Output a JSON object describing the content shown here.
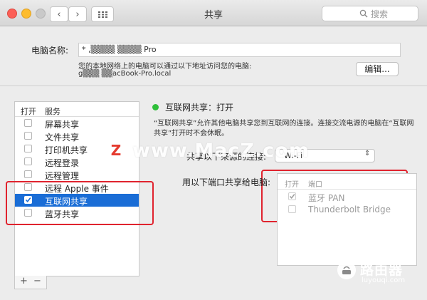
{
  "window": {
    "title": "共享"
  },
  "toolbar": {
    "search_placeholder": "搜索",
    "grid_icon": "grid-icon"
  },
  "computer_name": {
    "label": "电脑名称:",
    "value": "* ,▒▒▒▒ ▒▒▒▒ Pro",
    "hint": "您的本地网络上的电脑可以通过以下地址访问您的电脑:",
    "address": "g▒▒▒ ▒▒acBook-Pro.local",
    "edit_button": "编辑..."
  },
  "services": {
    "header_on": "打开",
    "header_service": "服务",
    "items": [
      {
        "label": "屏幕共享",
        "checked": false,
        "selected": false
      },
      {
        "label": "文件共享",
        "checked": false,
        "selected": false
      },
      {
        "label": "打印机共享",
        "checked": false,
        "selected": false
      },
      {
        "label": "远程登录",
        "checked": false,
        "selected": false
      },
      {
        "label": "远程管理",
        "checked": false,
        "selected": false
      },
      {
        "label": "远程 Apple 事件",
        "checked": false,
        "selected": false
      },
      {
        "label": "互联网共享",
        "checked": true,
        "selected": true
      },
      {
        "label": "蓝牙共享",
        "checked": false,
        "selected": false
      }
    ]
  },
  "detail": {
    "status_color": "#2fbf3a",
    "status": "互联网共享：打开",
    "description_line1": "“互联网共享”允许其他电脑共享您到互联网的连接。连接交流电源的电脑在“互联网",
    "description_line2": "共享”打开时不会休眠。",
    "share_from_label": "共享以下来源的连接:",
    "share_from_value": "Wi-Fi",
    "to_label": "用以下端口共享给电脑:",
    "ports_header_on": "打开",
    "ports_header_port": "端口",
    "ports": [
      {
        "label": "蓝牙 PAN",
        "checked": true
      },
      {
        "label": "Thunderbolt Bridge",
        "checked": false
      }
    ]
  },
  "watermarks": {
    "macz_text": "www.MacZ.com",
    "macz_logo": "Z",
    "luyou_text": "路由器",
    "luyou_url": "luyouqi.com"
  },
  "colors": {
    "accent": "#1a6dd6",
    "annotation": "#e0232e"
  }
}
